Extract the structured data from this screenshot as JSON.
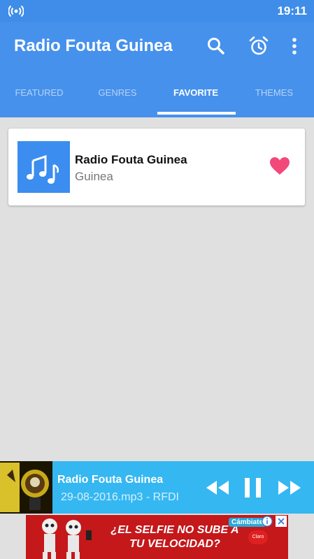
{
  "status_bar": {
    "time": "19:11",
    "left_icon": "radio-signal-icon"
  },
  "app_bar": {
    "title": "Radio Fouta Guinea",
    "actions": [
      "search-icon",
      "alarm-icon",
      "more-vert-icon"
    ]
  },
  "tabs": [
    {
      "label": "FEATURED",
      "active": false
    },
    {
      "label": "GENRES",
      "active": false
    },
    {
      "label": "FAVORITE",
      "active": true
    },
    {
      "label": "THEMES",
      "active": false
    }
  ],
  "favorites": [
    {
      "name": "Radio Fouta Guinea",
      "country": "Guinea",
      "thumb_icon": "music-notes-icon",
      "favorite_icon": "heart-icon"
    }
  ],
  "player": {
    "title": "Radio Fouta Guinea",
    "subtitle": "29-08-2016.mp3 - RFDI",
    "controls": [
      "rewind-icon",
      "pause-icon",
      "fast-forward-icon"
    ]
  },
  "ad": {
    "text": "¿EL SELFIE NO SUBE A TU VELOCIDAD?",
    "cta": "Cámbiate",
    "brand": "Claro"
  },
  "colors": {
    "primary": "#4691ec",
    "status_bar": "#3f8de8",
    "background": "#e0e0e0",
    "favorite": "#f2487a",
    "player": "#35b7f2",
    "ad_background": "#c4181b"
  }
}
